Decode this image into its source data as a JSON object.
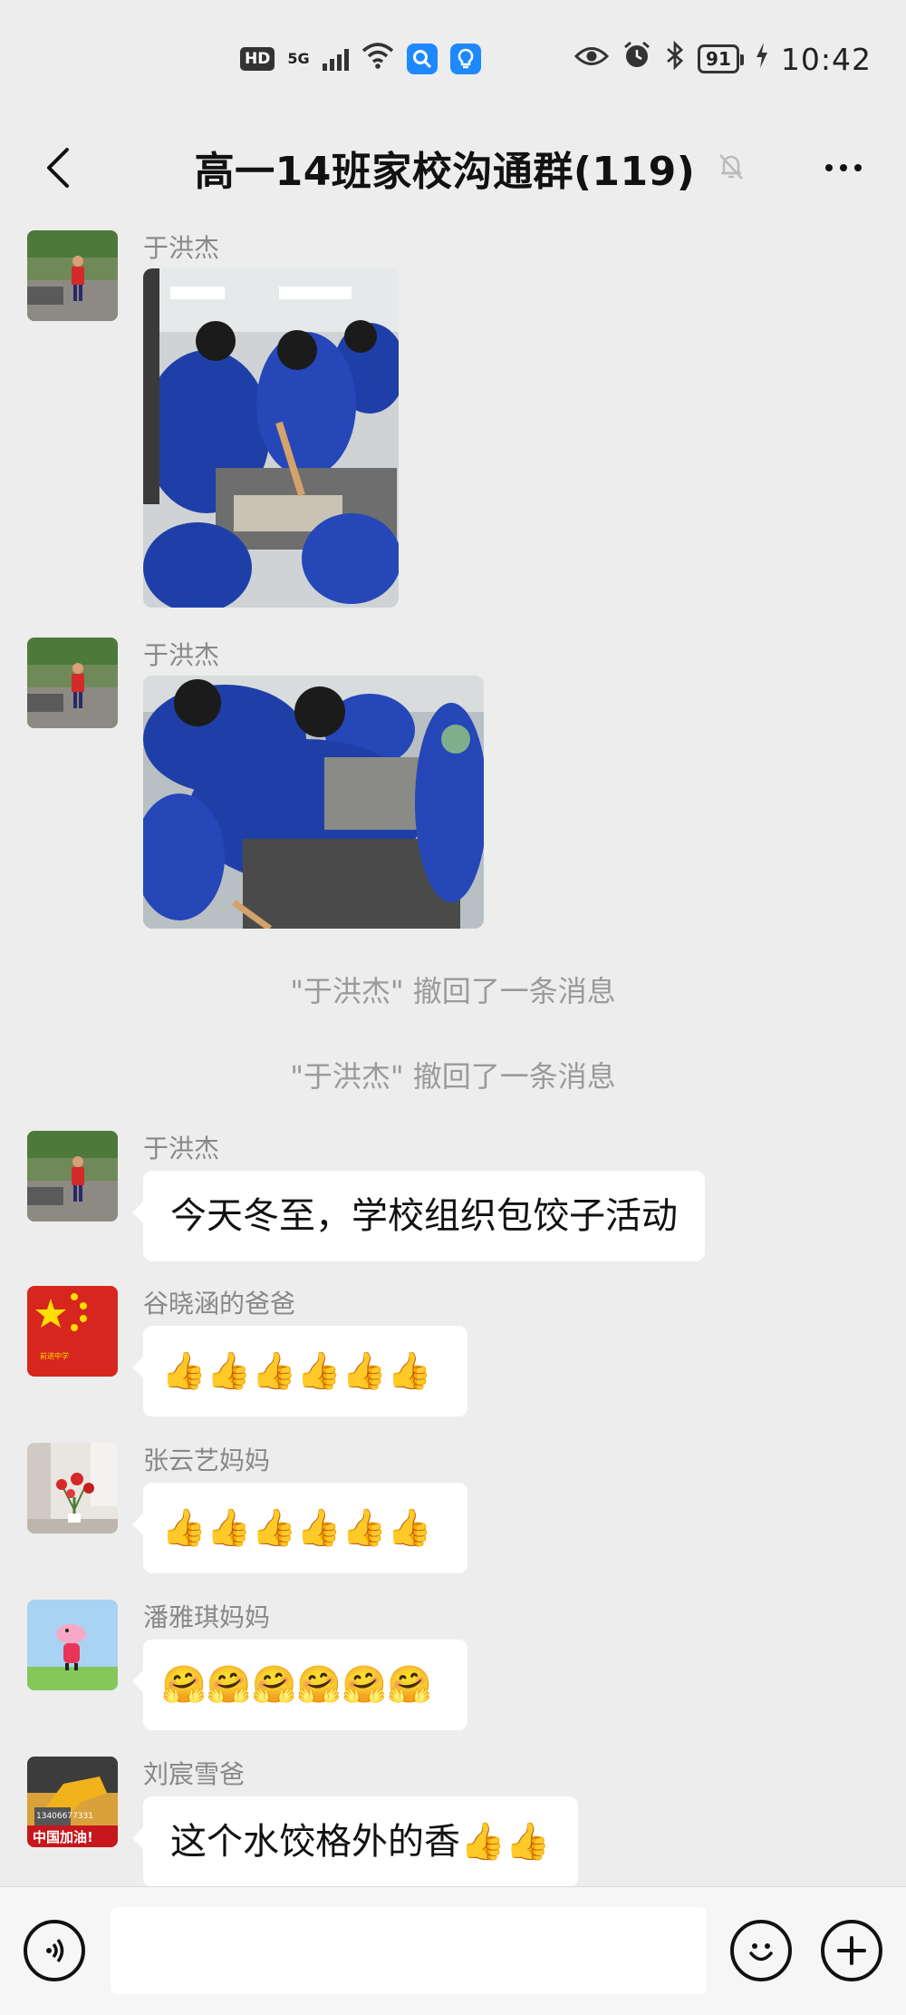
{
  "status_bar": {
    "hd": "HD",
    "network": "5G",
    "battery": "91",
    "time": "10:42"
  },
  "header": {
    "title": "高一14班家校沟通群(119)"
  },
  "messages": [
    {
      "sender": "于洪杰",
      "type": "image"
    },
    {
      "sender": "于洪杰",
      "type": "image"
    },
    {
      "sender": "于洪杰",
      "text": "今天冬至，学校组织包饺子活动"
    },
    {
      "sender": "谷晓涵的爸爸",
      "emoji": "👍👍👍👍👍👍"
    },
    {
      "sender": "张云艺妈妈",
      "emoji": "👍👍👍👍👍👍"
    },
    {
      "sender": "潘雅琪妈妈",
      "emoji": "🤗🤗🤗🤗🤗🤗"
    },
    {
      "sender": "刘宸雪爸",
      "text": "这个水饺格外的香👍👍"
    }
  ],
  "system_notes": [
    "\"于洪杰\" 撤回了一条消息",
    "\"于洪杰\" 撤回了一条消息"
  ],
  "avatar_texts": {
    "flag": "前进中学",
    "excavator": "中国加油!",
    "phone": "13406677331"
  },
  "input": {
    "placeholder": ""
  },
  "colors": {
    "background": "#ededed",
    "bubble": "#ffffff",
    "uniform_blue": "#1f3fa8"
  }
}
